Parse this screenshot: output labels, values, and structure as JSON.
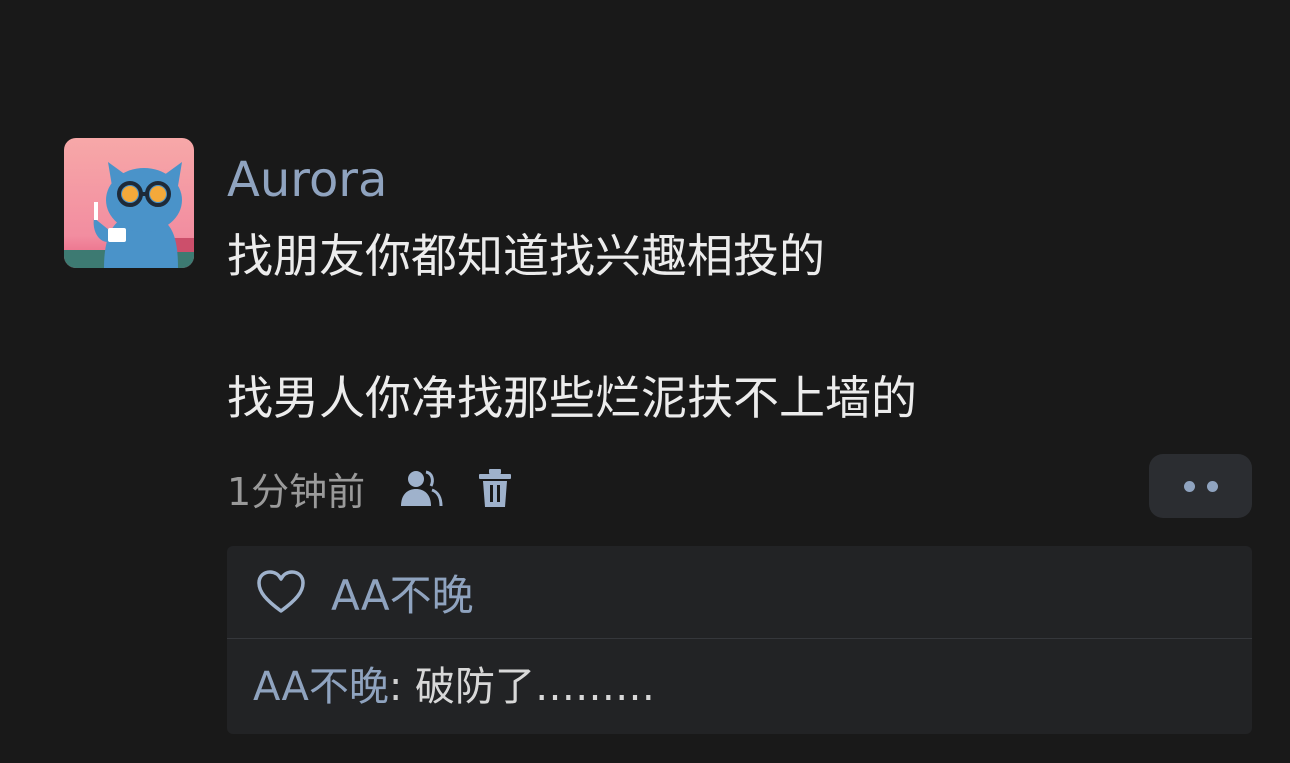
{
  "comment": {
    "username": "Aurora",
    "avatar_icon": "cat-with-sunglasses-avatar",
    "lines": [
      "找朋友你都知道找兴趣相投的",
      "找男人你净找那些烂泥扶不上墙的"
    ],
    "time": "1分钟前"
  },
  "actions": {
    "friends_icon": "friends-icon",
    "delete_icon": "trash-icon",
    "more_icon": "more-dots-icon"
  },
  "likes": {
    "heart_icon": "heart-icon",
    "liker": "AA不晚"
  },
  "reply": {
    "author": "AA不晚",
    "separator": ": ",
    "text": "破防了………"
  },
  "colors": {
    "background": "#191919",
    "accent": "#8fa3bf",
    "panel": "#222325",
    "text": "#ececec",
    "muted": "#9a9a9a"
  }
}
